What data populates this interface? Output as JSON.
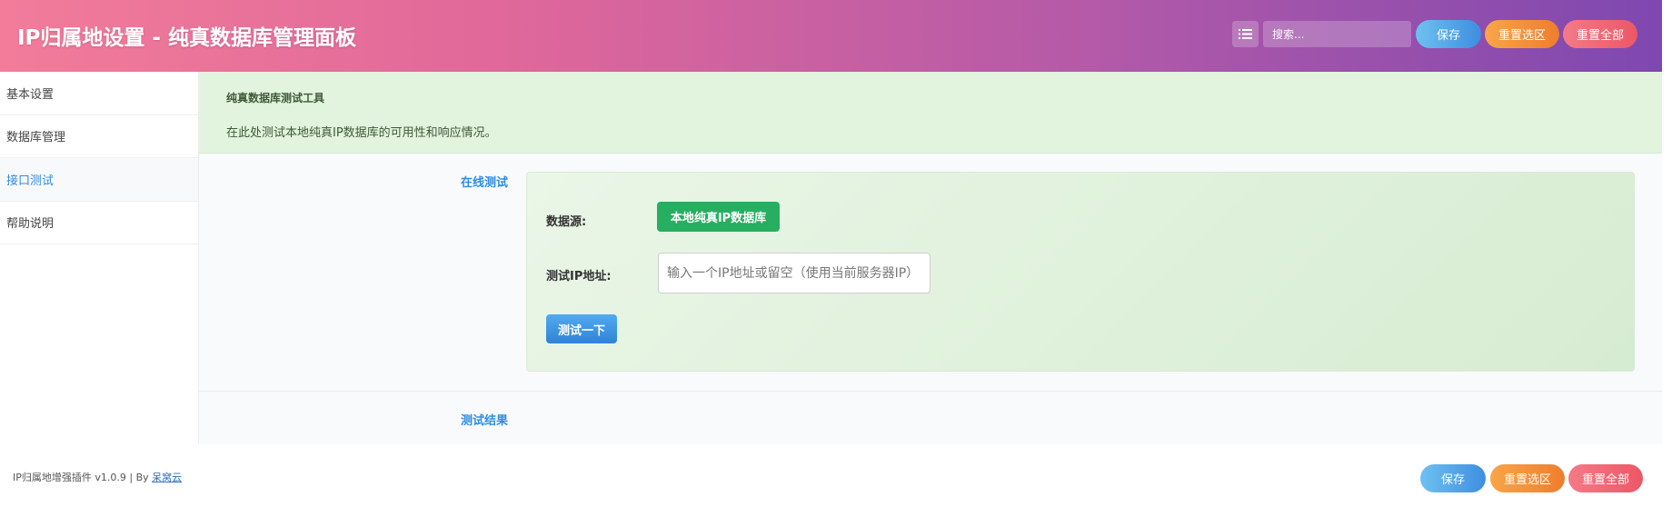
{
  "header": {
    "title": "IP归属地设置 - 纯真数据库管理面板",
    "search_placeholder": "搜索...",
    "save_label": "保存",
    "reset_selection_label": "重置选区",
    "reset_all_label": "重置全部"
  },
  "sidebar": {
    "items": [
      {
        "label": "基本设置"
      },
      {
        "label": "数据库管理"
      },
      {
        "label": "接口测试"
      },
      {
        "label": "帮助说明"
      }
    ],
    "active_index": 2
  },
  "notice": {
    "title": "纯真数据库测试工具",
    "text": "在此处测试本地纯真IP数据库的可用性和响应情况。"
  },
  "online_test": {
    "section_label": "在线测试",
    "source_label": "数据源:",
    "source_button": "本地纯真IP数据库",
    "ip_label": "测试IP地址:",
    "ip_placeholder": "输入一个IP地址或留空（使用当前服务器IP）",
    "ip_value": "",
    "test_button": "测试一下"
  },
  "results": {
    "section_label": "测试结果"
  },
  "footer": {
    "version_text": "IP归属地增强插件 v1.0.9 | By ",
    "author_link": "呆窝云",
    "save_label": "保存",
    "reset_selection_label": "重置选区",
    "reset_all_label": "重置全部"
  },
  "colors": {
    "header_gradient_start": "#f27c9a",
    "header_gradient_end": "#7e48b0",
    "accent_blue": "#2f8de0",
    "success_green": "#27ae60",
    "notice_bg": "#e2f3de"
  }
}
